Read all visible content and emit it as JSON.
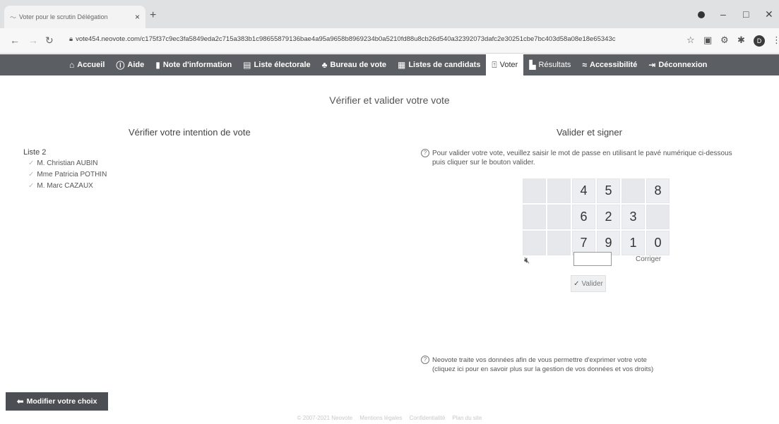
{
  "browser": {
    "tab_title": "Voter pour le scrutin Délégation",
    "tab_close": "×",
    "new_tab": "+",
    "url": "vote454.neovote.com/c175f37c9ec3fa5849eda2c715a383b1c98655879136bae4a95a9658b8969234b0a5210fd88u8cb26d540a32392073dafc2e30251cbe7bc403d58a08e18e65343c"
  },
  "nav": {
    "items": [
      {
        "icon": "home-icon",
        "label": "Accueil"
      },
      {
        "icon": "help-icon",
        "label": "Aide"
      },
      {
        "icon": "document-icon",
        "label": "Note d'information"
      },
      {
        "icon": "list-icon",
        "label": "Liste électorale"
      },
      {
        "icon": "people-icon",
        "label": "Bureau de vote"
      },
      {
        "icon": "card-icon",
        "label": "Listes de candidats"
      },
      {
        "icon": "ballot-icon",
        "label": "Voter"
      },
      {
        "icon": "bar-chart-icon",
        "label": "Résultats"
      },
      {
        "icon": "accessibility-icon",
        "label": "Accessibilité"
      },
      {
        "icon": "logout-icon",
        "label": "Déconnexion"
      }
    ],
    "active": "Voter"
  },
  "page": {
    "title": "Vérifier et valider votre vote",
    "left_title": "Vérifier votre intention de vote",
    "right_title": "Valider et signer",
    "list_name": "Liste 2",
    "candidates": [
      "M. Christian AUBIN",
      "Mme Patricia POTHIN",
      "M. Marc CAZAUX"
    ],
    "instruction_line1": "Pour valider votre vote, veuillez saisir le mot de passe en utilisant le pavé numérique ci-dessous",
    "instruction_line2": "puis cliquer sur le bouton valider.",
    "keypad": [
      [
        "",
        "",
        "4",
        "5",
        "",
        "8"
      ],
      [
        "",
        "",
        "6",
        "2",
        "3",
        ""
      ],
      [
        "",
        "",
        "7",
        "9",
        "1",
        "0"
      ]
    ],
    "correct_label": "Corriger",
    "validate_label": "Valider",
    "privacy_line1": "Neovote traite vos données afin de vous permettre d'exprimer votre vote",
    "privacy_line2": "(cliquez ici pour en savoir plus sur la gestion de vos données et vos droits)",
    "modify_label": "Modifier votre choix"
  },
  "footer": {
    "copyright": "© 2007-2021 Neovote",
    "links": [
      "Mentions légales",
      "Confidentialité",
      "Plan du site"
    ]
  }
}
